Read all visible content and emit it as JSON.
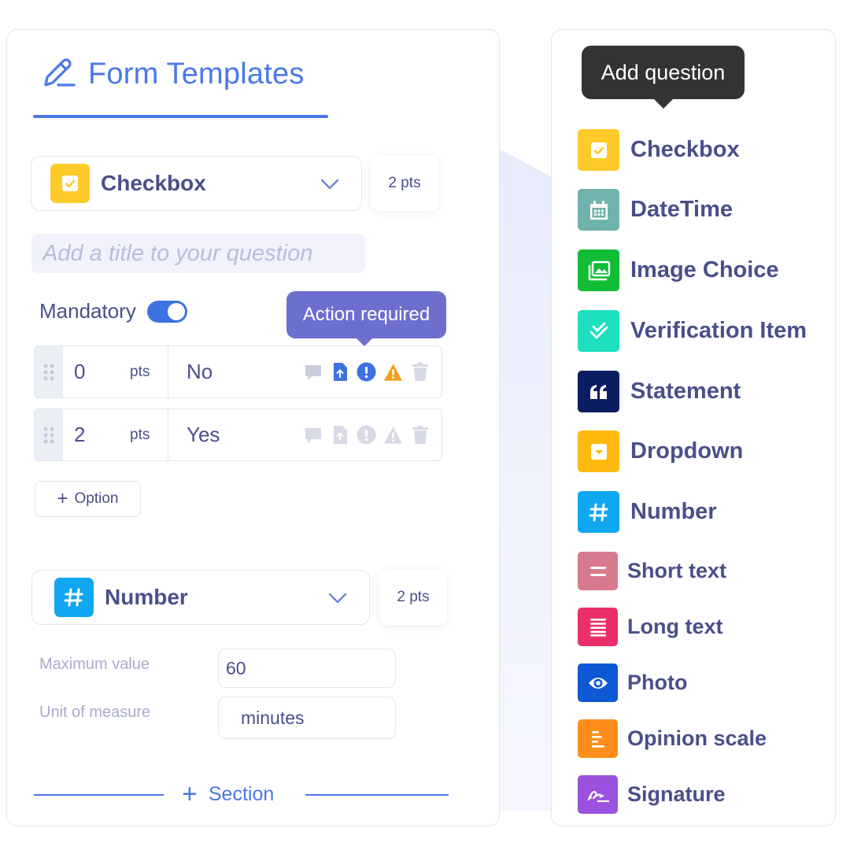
{
  "header": {
    "title": "Form Templates"
  },
  "question1": {
    "type_label": "Checkbox",
    "points": "2 pts",
    "title_placeholder": "Add a title to your question",
    "mandatory_label": "Mandatory",
    "mandatory_on": true,
    "tooltip": "Action required",
    "options": [
      {
        "score": "0",
        "unit": "pts",
        "text": "No"
      },
      {
        "score": "2",
        "unit": "pts",
        "text": "Yes"
      }
    ],
    "add_option_label": "Option"
  },
  "question2": {
    "type_label": "Number",
    "points": "2 pts",
    "max_label": "Maximum value",
    "max_value": "60",
    "unit_label": "Unit of measure",
    "unit_value": "minutes"
  },
  "section_label": "Section",
  "add_question": {
    "tooltip": "Add question",
    "types": [
      {
        "label": "Checkbox",
        "color": "#ffcb2b",
        "icon": "checkbox-icon"
      },
      {
        "label": "DateTime",
        "color": "#6fb3ac",
        "icon": "calendar-icon"
      },
      {
        "label": "Image Choice",
        "color": "#11bd36",
        "icon": "image-icon"
      },
      {
        "label": "Verification Item",
        "color": "#1de0be",
        "icon": "check-double-icon"
      },
      {
        "label": "Statement",
        "color": "#0c1c61",
        "icon": "quote-icon"
      },
      {
        "label": "Dropdown",
        "color": "#ffb90f",
        "icon": "dropdown-icon"
      },
      {
        "label": "Number",
        "color": "#0fa6f2",
        "icon": "hash-icon"
      },
      {
        "label": "Short text",
        "color": "#d77a8e",
        "icon": "short-text-icon"
      },
      {
        "label": "Long text",
        "color": "#ec2f6a",
        "icon": "long-text-icon"
      },
      {
        "label": "Photo",
        "color": "#0f58d3",
        "icon": "eye-icon"
      },
      {
        "label": "Opinion scale",
        "color": "#ff8d1b",
        "icon": "scale-icon"
      },
      {
        "label": "Signature",
        "color": "#9b53df",
        "icon": "signature-icon"
      }
    ]
  }
}
